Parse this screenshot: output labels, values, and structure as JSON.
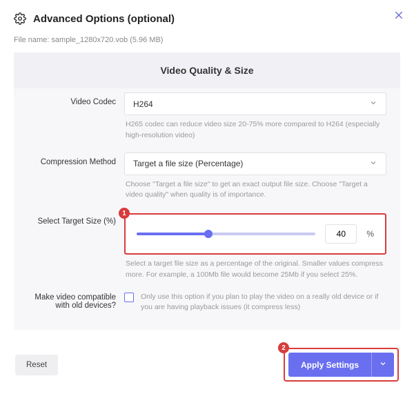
{
  "header": {
    "title": "Advanced Options (optional)"
  },
  "file": {
    "label": "File name:",
    "value": "sample_1280x720.vob (5.96 MB)"
  },
  "panel": {
    "title": "Video Quality & Size"
  },
  "codec": {
    "label": "Video Codec",
    "value": "H264",
    "hint": "H265 codec can reduce video size 20-75% more compared to H264 (especially high-resolution video)"
  },
  "method": {
    "label": "Compression Method",
    "value": "Target a file size (Percentage)",
    "hint": "Choose \"Target a file size\" to get an exact output file size. Choose \"Target a video quality\" when quality is of importance."
  },
  "target": {
    "label": "Select Target Size (%)",
    "value": "40",
    "symbol": "%",
    "hint": "Select a target file size as a percentage of the original. Smaller values compress more. For example, a 100Mb file would become 25Mb if you select 25%."
  },
  "compat": {
    "label": "Make video compatible with old devices?",
    "text": "Only use this option if you plan to play the video on a really old device or if you are having playback issues (it compress less)"
  },
  "footer": {
    "reset": "Reset",
    "apply": "Apply Settings"
  },
  "annotations": {
    "badge1": "1",
    "badge2": "2"
  }
}
